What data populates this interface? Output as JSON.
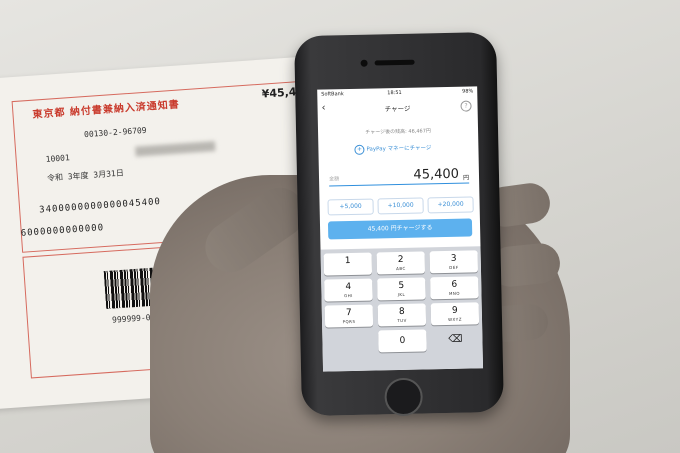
{
  "paper": {
    "title": "東京都  納付書兼納入済通知書",
    "amount": "¥45,400",
    "line_code": "00130-2-96709",
    "line_number": "10001",
    "line_date": "令和 3年度    3月31日",
    "row_number": "3400000000000045400",
    "row_number_2": "6000000000000",
    "barcode_caption": "999999-0-"
  },
  "phone": {
    "status": {
      "carrier": "SoftBank",
      "time": "18:51",
      "battery": "98%"
    },
    "nav": {
      "title": "チャージ",
      "back_icon": "chevron-left-icon",
      "help_icon": "question-icon"
    },
    "balance_text": "チャージ後の残高: 46,467円",
    "charge_link": "PayPay マネーにチャージ",
    "amount": {
      "label": "金額",
      "value": "45,400",
      "unit": "円"
    },
    "quick_add": [
      "+5,000",
      "+10,000",
      "+20,000"
    ],
    "submit_label": "45,400 円チャージする",
    "keypad": [
      {
        "n": "1",
        "l": ""
      },
      {
        "n": "2",
        "l": "ABC"
      },
      {
        "n": "3",
        "l": "DEF"
      },
      {
        "n": "4",
        "l": "GHI"
      },
      {
        "n": "5",
        "l": "JKL"
      },
      {
        "n": "6",
        "l": "MNO"
      },
      {
        "n": "7",
        "l": "PQRS"
      },
      {
        "n": "8",
        "l": "TUV"
      },
      {
        "n": "9",
        "l": "WXYZ"
      },
      {
        "n": "",
        "l": ""
      },
      {
        "n": "0",
        "l": ""
      },
      {
        "n": "⌫",
        "l": ""
      }
    ],
    "colors": {
      "accent": "#3a8fd6",
      "button": "#5db1ee",
      "keypad_bg": "#d1d4da"
    }
  }
}
